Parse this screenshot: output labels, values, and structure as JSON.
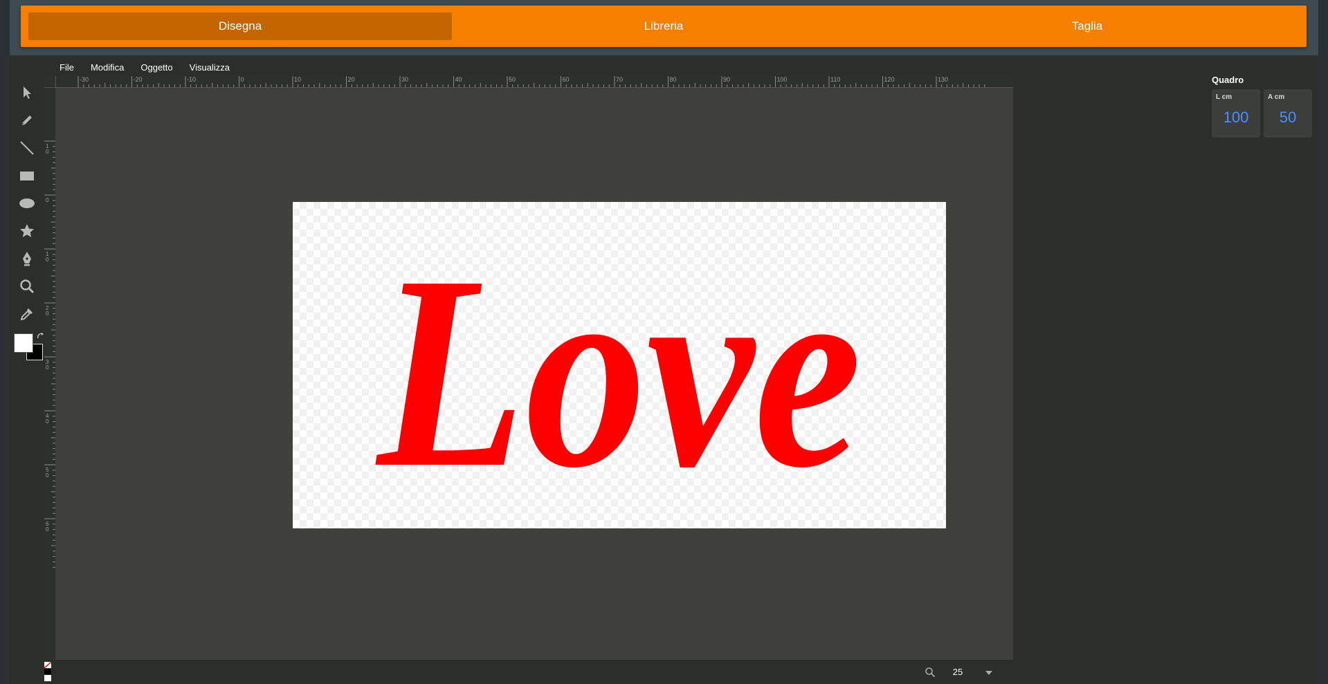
{
  "modes": [
    {
      "label": "Disegna",
      "active": true
    },
    {
      "label": "Libreria",
      "active": false
    },
    {
      "label": "Taglia",
      "active": false
    }
  ],
  "menu": [
    "File",
    "Modifica",
    "Oggetto",
    "Visualizza"
  ],
  "tools": [
    {
      "icon": "select-arrow-icon"
    },
    {
      "icon": "pencil-icon"
    },
    {
      "icon": "line-icon"
    },
    {
      "icon": "rectangle-icon"
    },
    {
      "icon": "ellipse-icon"
    },
    {
      "icon": "star-icon"
    },
    {
      "icon": "pen-nib-icon"
    },
    {
      "icon": "zoom-icon"
    },
    {
      "icon": "eyedropper-icon"
    }
  ],
  "colors": {
    "fill": "#ffffff",
    "stroke": "#000000",
    "accent": "#f77f00",
    "artwork": "#ff0000"
  },
  "ruler": {
    "h_labels": [
      "-30",
      "-20",
      "-10",
      "0",
      "10",
      "20",
      "30",
      "40",
      "50",
      "60",
      "70",
      "80",
      "90",
      "100",
      "110",
      "120",
      "130"
    ],
    "v_labels": [
      "10",
      "0",
      "10",
      "20",
      "30",
      "40",
      "50",
      "60"
    ]
  },
  "panel": {
    "title": "Quadro",
    "width_label": "L cm",
    "width_value": "100",
    "height_label": "A cm",
    "height_value": "50"
  },
  "artwork": {
    "text": "Love"
  },
  "status": {
    "zoom": "25"
  }
}
